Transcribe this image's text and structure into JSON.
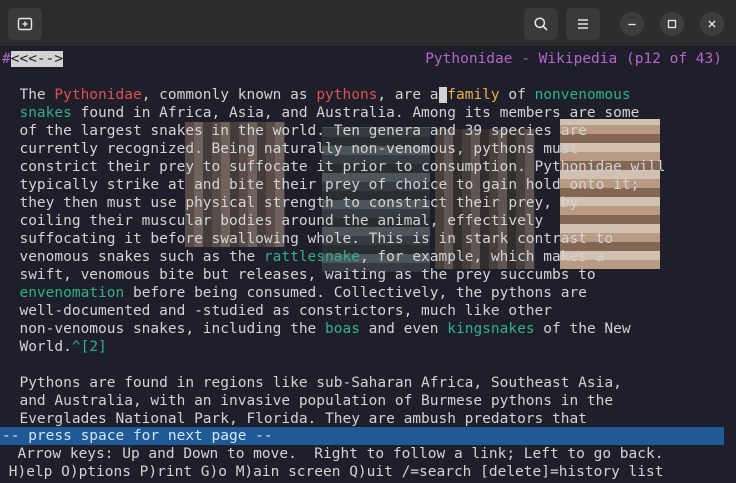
{
  "header": {
    "new_tab_icon": "new-tab-icon",
    "search_icon": "search-icon",
    "menu_icon": "hamburger-menu-icon",
    "minimize_icon": "minimize-icon",
    "maximize_icon": "maximize-icon",
    "close_icon": "close-icon"
  },
  "browser": {
    "nav_marker_prefix": "#",
    "nav_marker_box": "<<<-->",
    "page_title": "Pythonidae - Wikipedia (p12 of 43)"
  },
  "content": {
    "p1": {
      "l1_a": "The ",
      "l1_link1": "Pythonidae",
      "l1_b": ", commonly known as ",
      "l1_link2": "pythons",
      "l1_c": ", are a",
      "l1_cursor": " ",
      "l1_link3": "family",
      "l1_d": " of ",
      "l1_link4": "nonvenomous",
      "l2_link": "snakes",
      "l2_rest": " found in Africa, Asia, and Australia. Among its members are some",
      "l3": "of the largest snakes in the world. Ten genera and 39 species are",
      "l4": "currently recognized. Being naturally non-venomous, pythons must",
      "l5": "constrict their prey to suffocate it prior to consumption. Pythonidae will",
      "l6": "typically strike at and bite their prey of choice to gain hold onto it;",
      "l7": "they then must use physical strength to constrict their prey, by",
      "l8": "coiling their muscular bodies around the animal, effectively",
      "l9": "suffocating it before swallowing whole. This is in stark contrast to",
      "l10_a": "venomous snakes such as the ",
      "l10_link": "rattlesnake",
      "l10_b": ", for example, which makes a",
      "l11": "swift, venomous bite but releases, waiting as the prey succumbs to",
      "l12_link": "envenomation",
      "l12_rest": " before being consumed. Collectively, the pythons are",
      "l13": "well-documented and -studied as constrictors, much like other",
      "l14_a": "non-venomous snakes, including the ",
      "l14_link1": "boas",
      "l14_b": " and even ",
      "l14_link2": "kingsnakes",
      "l14_c": " of the New",
      "l15_a": "World.",
      "l15_ref": "^[2]"
    },
    "p2": {
      "l1": "Pythons are found in regions like sub-Saharan Africa, Southeast Asia,",
      "l2": "and Australia, with an invasive population of Burmese pythons in the",
      "l3": "Everglades National Park, Florida. They are ambush predators that"
    }
  },
  "status": {
    "prompt": "-- press space for next page --",
    "help1": "  Arrow keys: Up and Down to move.  Right to follow a link; Left to go back.",
    "help2": " H)elp O)ptions P)rint G)o M)ain screen Q)uit /=search [delete]=history list"
  },
  "colors": {
    "link": "#2fb08a",
    "visited_link": "#e0504f",
    "active_link": "#e8b44a",
    "title": "#b267c9",
    "statusbar": "#1f5a96"
  }
}
